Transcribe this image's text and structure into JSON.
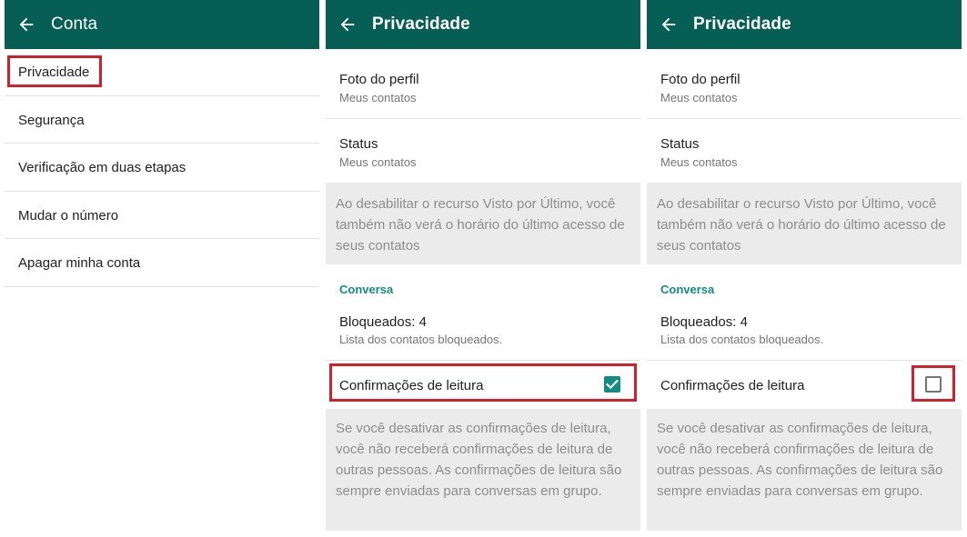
{
  "panel1": {
    "title": "Conta",
    "items": [
      {
        "label": "Privacidade"
      },
      {
        "label": "Segurança"
      },
      {
        "label": "Verificação em duas etapas"
      },
      {
        "label": "Mudar o número"
      },
      {
        "label": "Apagar minha conta"
      }
    ]
  },
  "panel2": {
    "title": "Privacidade",
    "profile_photo": {
      "label": "Foto do perfil",
      "value": "Meus contatos"
    },
    "status": {
      "label": "Status",
      "value": "Meus contatos"
    },
    "last_seen_info": "Ao desabilitar o recurso Visto por Último, você também não verá o horário do último acesso de seus contatos",
    "section_label": "Conversa",
    "blocked": {
      "label": "Bloqueados: 4",
      "value": "Lista dos contatos bloqueados."
    },
    "read_receipts": {
      "label": "Confirmações de leitura",
      "checked": true
    },
    "read_receipts_info": "Se você desativar as confirmações de leitura, você não receberá confirmações de leitura de outras pessoas. As confirmações de leitura são sempre enviadas para conversas em grupo."
  },
  "panel3": {
    "title": "Privacidade",
    "profile_photo": {
      "label": "Foto do perfil",
      "value": "Meus contatos"
    },
    "status": {
      "label": "Status",
      "value": "Meus contatos"
    },
    "last_seen_info": "Ao desabilitar o recurso Visto por Último, você também não verá o horário do último acesso de seus contatos",
    "section_label": "Conversa",
    "blocked": {
      "label": "Bloqueados: 4",
      "value": "Lista dos contatos bloqueados."
    },
    "read_receipts": {
      "label": "Confirmações de leitura",
      "checked": false
    },
    "read_receipts_info": "Se você desativar as confirmações de leitura, você não receberá confirmações de leitura de outras pessoas. As confirmações de leitura são sempre enviadas para conversas em grupo."
  },
  "colors": {
    "app_bar": "#075e54",
    "accent": "#128c7e",
    "highlight": "#d0202c",
    "info_background": "#ebebeb"
  },
  "icons": {
    "back": "back-arrow-icon",
    "checked": "checkbox-checked-icon",
    "unchecked": "checkbox-unchecked-icon"
  }
}
